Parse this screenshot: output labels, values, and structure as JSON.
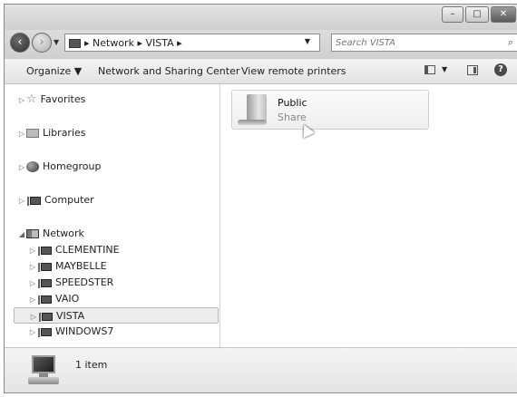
{
  "window": {
    "controls": {
      "minimize": "–",
      "maximize": "□",
      "close": "✕"
    }
  },
  "address": {
    "path": "▸ Network ▸ VISTA ▸",
    "dropdown": "▼",
    "refresh": "↻",
    "search_placeholder": "Search VISTA",
    "search_icon": "⌕"
  },
  "toolbar": {
    "organize_label": "Organize ▼",
    "network_sharing_label": "Network and Sharing Center",
    "view_remote_printers_label": "View remote printers",
    "view_dropdown": "▼",
    "help": "?"
  },
  "nav": {
    "favorites": "Favorites",
    "libraries": "Libraries",
    "homegroup": "Homegroup",
    "computer": "Computer",
    "network": "Network",
    "network_children": [
      "CLEMENTINE",
      "MAYBELLE",
      "SPEEDSTER",
      "VAIO",
      "VISTA",
      "WINDOWS7"
    ],
    "selected": "VISTA",
    "collapsed_arrow": "▷",
    "expanded_arrow": "◢"
  },
  "content": {
    "items": [
      {
        "name": "Public",
        "type": "Share"
      }
    ]
  },
  "details": {
    "count": "1 item"
  }
}
